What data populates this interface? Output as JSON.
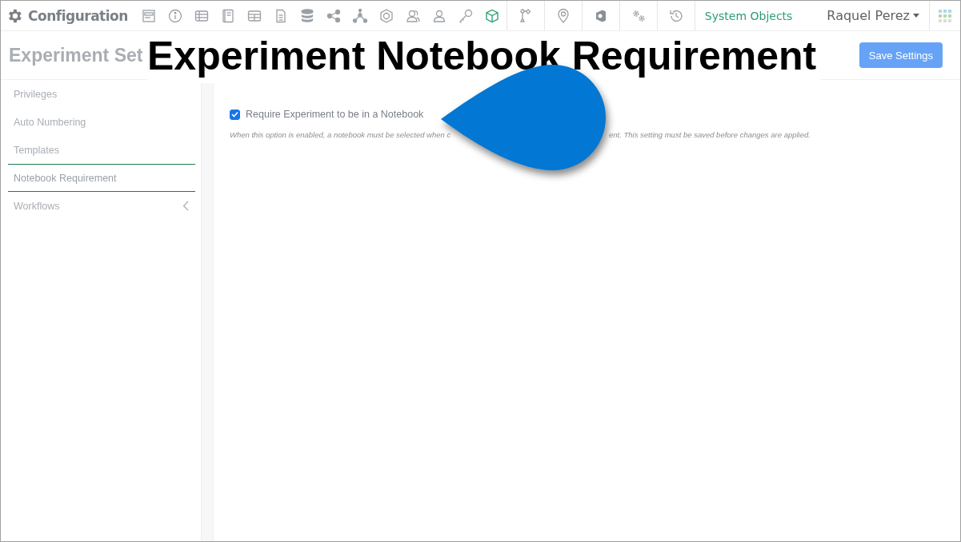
{
  "topbar": {
    "title": "Configuration",
    "link": "System Objects",
    "user": "Raquel Perez"
  },
  "overlay_title": "Experiment Notebook Requirement",
  "page": {
    "heading": "Experiment Set",
    "save_button": "Save Settings"
  },
  "sidebar": {
    "items": [
      {
        "label": "Privileges",
        "selected": false,
        "expandable": false
      },
      {
        "label": "Auto Numbering",
        "selected": false,
        "expandable": false
      },
      {
        "label": "Templates",
        "selected": false,
        "expandable": false
      },
      {
        "label": "Notebook Requirement",
        "selected": true,
        "expandable": false
      },
      {
        "label": "Workflows",
        "selected": false,
        "expandable": true
      }
    ]
  },
  "setting": {
    "label": "Require Experiment to be in a Notebook",
    "checked": true,
    "description_parts": [
      "When this option is enabled, a notebook must be selected when c",
      "ent. This setting must be saved before changes are applied."
    ]
  }
}
